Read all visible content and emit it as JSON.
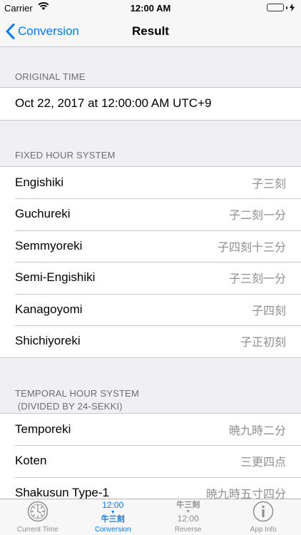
{
  "status": {
    "carrier": "Carrier",
    "time": "12:00 AM"
  },
  "nav": {
    "back_label": "Conversion",
    "title": "Result"
  },
  "original": {
    "header": "ORIGINAL TIME",
    "value": "Oct 22, 2017 at 12:00:00 AM UTC+9"
  },
  "fixed": {
    "header": "FIXED HOUR SYSTEM",
    "rows": [
      {
        "label": "Engishiki",
        "value": "子三刻"
      },
      {
        "label": "Guchureki",
        "value": "子二刻一分"
      },
      {
        "label": "Semmyoreki",
        "value": "子四刻十三分"
      },
      {
        "label": "Semi-Engishiki",
        "value": "子三刻一分"
      },
      {
        "label": "Kanagoyomi",
        "value": "子四刻"
      },
      {
        "label": "Shichiyoreki",
        "value": "子正初刻"
      }
    ]
  },
  "temporal": {
    "header_line1": "TEMPORAL HOUR SYSTEM",
    "header_line2": " (DIVIDED BY 24-SEKKI)",
    "rows": [
      {
        "label": "Temporeki",
        "value": "暁九時二分"
      },
      {
        "label": "Koten",
        "value": "三更四点"
      },
      {
        "label": "Shakusun Type-1",
        "value": "暁九時五寸四分"
      }
    ]
  },
  "tabs": [
    {
      "label": "Current Time",
      "icon": "clock-icon"
    },
    {
      "label": "Conversion",
      "icon_time": "12:00",
      "icon_kanji": "牛三刻",
      "icon": "conversion-icon"
    },
    {
      "label": "Reverse",
      "icon_kanji": "牛三刻",
      "icon_time": "12:00",
      "icon": "reverse-icon"
    },
    {
      "label": "App Info",
      "icon": "info-icon"
    }
  ],
  "colors": {
    "accent": "#007aff",
    "battery": "#4cd964",
    "secondary_text": "#8e8e93"
  }
}
